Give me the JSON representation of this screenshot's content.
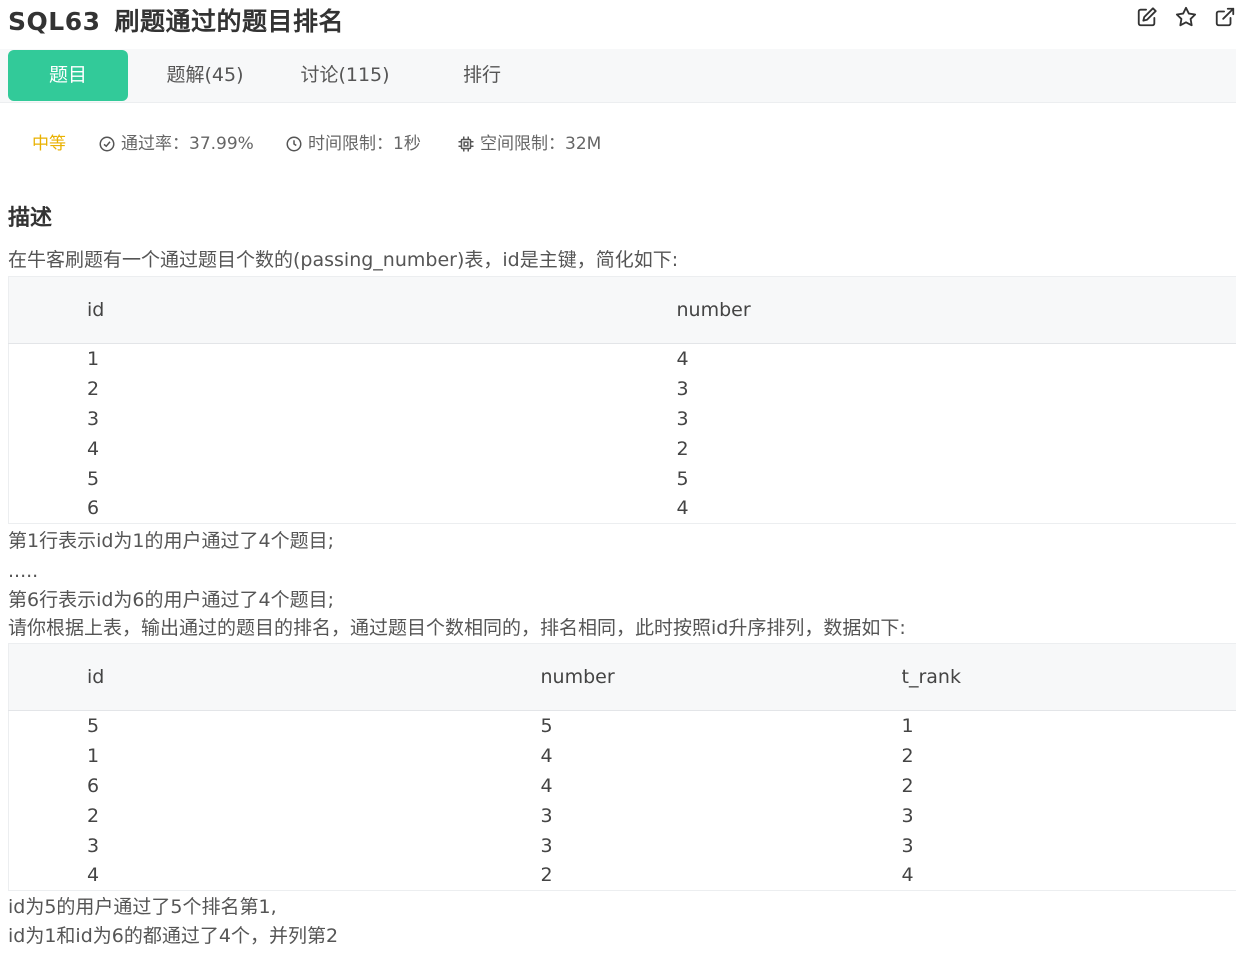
{
  "header": {
    "code": "SQL63",
    "title": "刷题通过的题目排名",
    "icons": [
      "edit-icon",
      "star-icon",
      "share-icon"
    ]
  },
  "tabs": [
    {
      "label": "题目",
      "active": true
    },
    {
      "label": "题解(45)",
      "active": false
    },
    {
      "label": "讨论(115)",
      "active": false
    },
    {
      "label": "排行",
      "active": false
    }
  ],
  "meta": {
    "difficulty": "中等",
    "pass_rate": "通过率：37.99%",
    "time_limit": "时间限制：1秒",
    "memory_limit": "空间限制：32M"
  },
  "colors": {
    "accent": "#32ca99",
    "difficulty": "#e9b100"
  },
  "description": {
    "title": "描述",
    "intro": "在牛客刷题有一个通过题目个数的(passing_number)表，id是主键，简化如下:",
    "table1": {
      "headers": [
        "id",
        "number"
      ],
      "rows": [
        [
          "1",
          "4"
        ],
        [
          "2",
          "3"
        ],
        [
          "3",
          "3"
        ],
        [
          "4",
          "2"
        ],
        [
          "5",
          "5"
        ],
        [
          "6",
          "4"
        ]
      ]
    },
    "line1": "第1行表示id为1的用户通过了4个题目;",
    "line2": ".....",
    "line3": "第6行表示id为6的用户通过了4个题目;",
    "line4": "请你根据上表，输出通过的题目的排名，通过题目个数相同的，排名相同，此时按照id升序排列，数据如下:",
    "table2": {
      "headers": [
        "id",
        "number",
        "t_rank"
      ],
      "rows": [
        [
          "5",
          "5",
          "1"
        ],
        [
          "1",
          "4",
          "2"
        ],
        [
          "6",
          "4",
          "2"
        ],
        [
          "2",
          "3",
          "3"
        ],
        [
          "3",
          "3",
          "3"
        ],
        [
          "4",
          "2",
          "4"
        ]
      ]
    },
    "line5": "id为5的用户通过了5个排名第1,",
    "line6": "id为1和id为6的都通过了4个，并列第2"
  }
}
